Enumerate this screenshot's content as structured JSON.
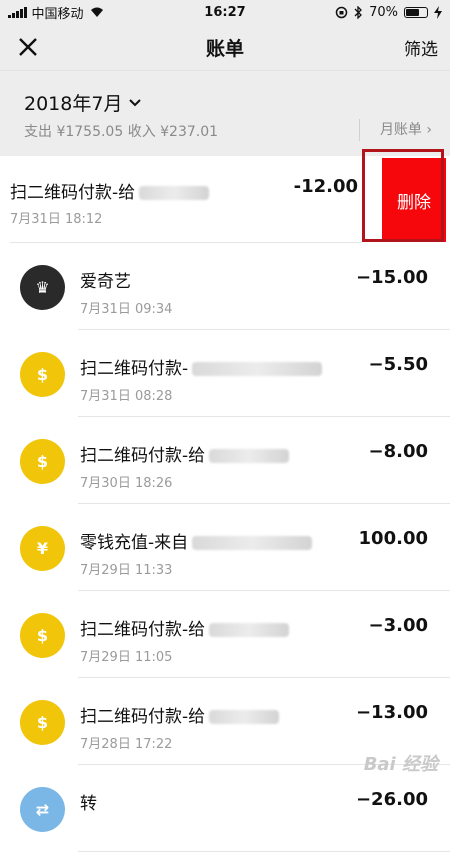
{
  "status_bar": {
    "carrier": "中国移动",
    "time": "16:27",
    "battery": "70%",
    "battery_level": 0.7
  },
  "navbar": {
    "close_label": "×",
    "title": "账单",
    "filter_label": "筛选"
  },
  "summary": {
    "month": "2018年7月",
    "totals": "支出 ¥1755.05 收入 ¥237.01",
    "monthly_link": "月账单 ›"
  },
  "swiped_row": {
    "title": "扫二维码付款-给",
    "date": "7月31日 18:12",
    "amount": "-12.00",
    "delete_label": "删除"
  },
  "rows": [
    {
      "title": "爱奇艺",
      "date": "7月31日 09:34",
      "amount": "−15.00",
      "icon": "iqiyi-logo-icon"
    },
    {
      "title": "扫二维码付款-",
      "date": "7月31日 08:28",
      "amount": "−5.50",
      "icon": "money-bag-icon"
    },
    {
      "title": "扫二维码付款-给",
      "date": "7月30日 18:26",
      "amount": "−8.00",
      "icon": "money-bag-icon"
    },
    {
      "title": "零钱充值-来自",
      "date": "7月29日 11:33",
      "amount": "100.00",
      "icon": "yuan-coin-icon"
    },
    {
      "title": "扫二维码付款-给",
      "date": "7月29日 11:05",
      "amount": "−3.00",
      "icon": "money-bag-icon"
    },
    {
      "title": "扫二维码付款-给",
      "date": "7月28日 17:22",
      "amount": "−13.00",
      "icon": "money-bag-icon"
    },
    {
      "title": "转",
      "date": "",
      "amount": "−26.00",
      "icon": "transfer-icon"
    }
  ],
  "watermark": "Bai 经验"
}
